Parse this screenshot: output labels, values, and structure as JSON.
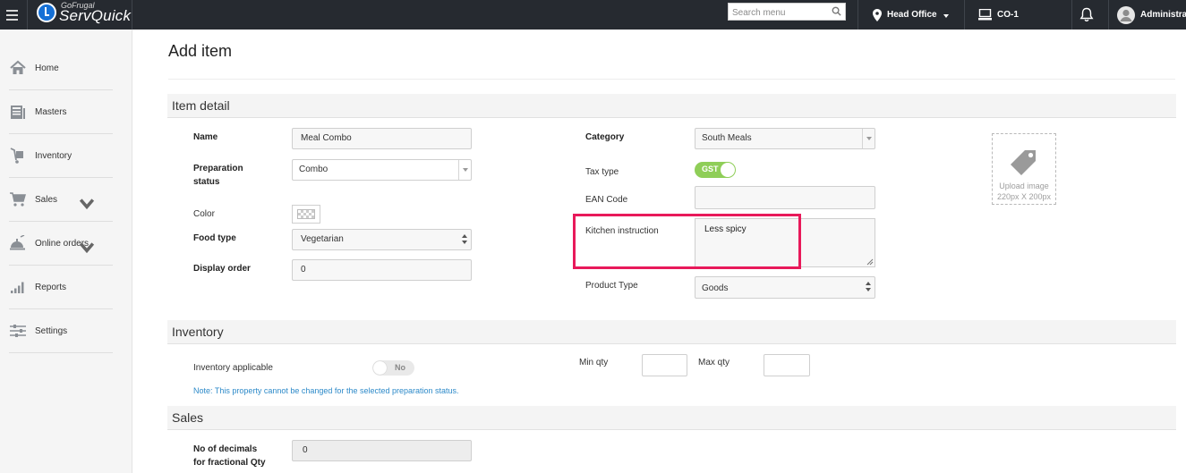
{
  "topbar": {
    "logo_brand": "GoFrugal",
    "logo_product": "ServQuick",
    "search_placeholder": "Search menu",
    "location": "Head Office",
    "counter": "CO-1",
    "user": "Administra"
  },
  "sidebar": {
    "items": [
      {
        "label": "Home",
        "icon": "home-icon"
      },
      {
        "label": "Masters",
        "icon": "masters-icon"
      },
      {
        "label": "Inventory",
        "icon": "inventory-icon"
      },
      {
        "label": "Sales",
        "icon": "cart-icon"
      },
      {
        "label": "Online orders",
        "icon": "online-orders-icon"
      },
      {
        "label": "Reports",
        "icon": "bar-chart-icon"
      },
      {
        "label": "Settings",
        "icon": "sliders-icon"
      }
    ]
  },
  "page": {
    "title": "Add item"
  },
  "item_detail": {
    "section_title": "Item detail",
    "name_label": "Name",
    "name_value": "Meal Combo",
    "prep_label_1": "Preparation",
    "prep_label_2": "status",
    "prep_value": "Combo",
    "color_label": "Color",
    "food_type_label": "Food type",
    "food_type_value": "Vegetarian",
    "display_order_label": "Display order",
    "display_order_value": "0",
    "category_label": "Category",
    "category_value": "South Meals",
    "tax_type_label": "Tax type",
    "tax_type_value": "GST",
    "ean_label": "EAN Code",
    "ean_value": "",
    "kitchen_label": "Kitchen instruction",
    "kitchen_value": "Less spicy",
    "product_type_label": "Product Type",
    "product_type_value": "Goods",
    "upload_line1": "Upload image",
    "upload_line2": "220px X 200px"
  },
  "inventory": {
    "section_title": "Inventory",
    "applicable_label": "Inventory applicable",
    "applicable_value": "No",
    "min_qty_label": "Min qty",
    "min_qty_value": "",
    "max_qty_label": "Max qty",
    "max_qty_value": "",
    "note": "Note: This property cannot be changed for the selected preparation status."
  },
  "sales": {
    "section_title": "Sales",
    "decimals_label_1": "No of decimals",
    "decimals_label_2": "for fractional Qty",
    "decimals_value": "0"
  },
  "colors": {
    "topbar_bg": "#262a30",
    "highlight": "#e8195a",
    "toggle_on": "#8fce58",
    "note": "#2d8ac9"
  }
}
